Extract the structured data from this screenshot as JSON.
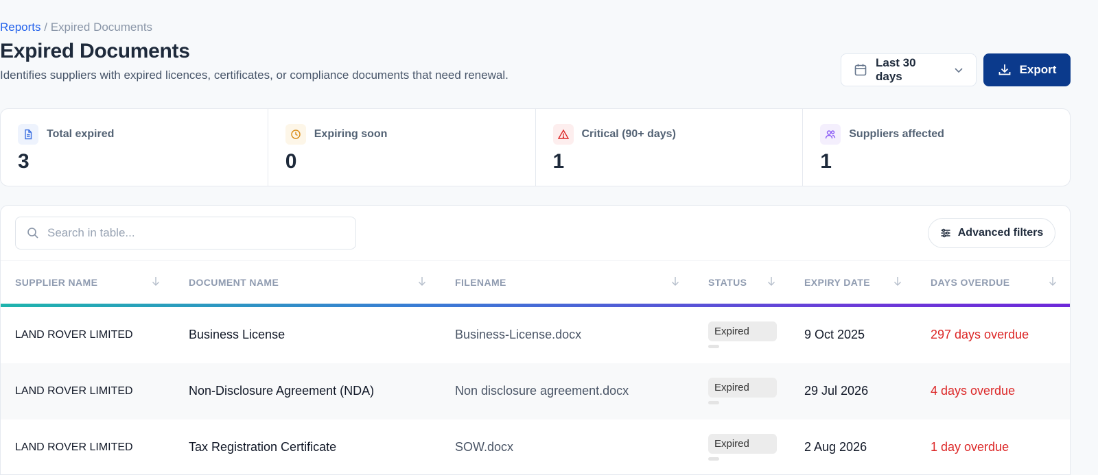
{
  "breadcrumb": {
    "parent": "Reports",
    "separator": " / ",
    "current": "Expired Documents"
  },
  "page": {
    "title": "Expired Documents",
    "description": "Identifies suppliers with expired licences, certificates, or compliance documents that need renewal."
  },
  "actions": {
    "date_range": "Last 30 days",
    "export": "Export"
  },
  "stats": [
    {
      "label": "Total expired",
      "value": "3",
      "icon": "document-icon"
    },
    {
      "label": "Expiring soon",
      "value": "0",
      "icon": "clock-icon"
    },
    {
      "label": "Critical (90+ days)",
      "value": "1",
      "icon": "warning-icon"
    },
    {
      "label": "Suppliers affected",
      "value": "1",
      "icon": "users-icon"
    }
  ],
  "table": {
    "search_placeholder": "Search in table...",
    "advanced_filters": "Advanced filters",
    "columns": [
      "Supplier Name",
      "Document Name",
      "Filename",
      "Status",
      "Expiry Date",
      "Days Overdue"
    ],
    "rows": [
      {
        "supplier": "LAND ROVER LIMITED",
        "document": "Business License",
        "filename": "Business-License.docx",
        "status": "Expired",
        "expiry": "9 Oct 2025",
        "overdue": "297 days overdue"
      },
      {
        "supplier": "LAND ROVER LIMITED",
        "document": "Non-Disclosure Agreement (NDA)",
        "filename": "Non disclosure agreement.docx",
        "status": "Expired",
        "expiry": "29 Jul 2026",
        "overdue": "4 days overdue"
      },
      {
        "supplier": "LAND ROVER LIMITED",
        "document": "Tax Registration Certificate",
        "filename": "SOW.docx",
        "status": "Expired",
        "expiry": "2 Aug 2026",
        "overdue": "1 day overdue"
      }
    ]
  },
  "colors": {
    "primary": "#0b3a8c",
    "link": "#2563eb",
    "overdue": "#dc2626",
    "accent_start": "#1fb4ad",
    "accent_end": "#6d28d9"
  }
}
